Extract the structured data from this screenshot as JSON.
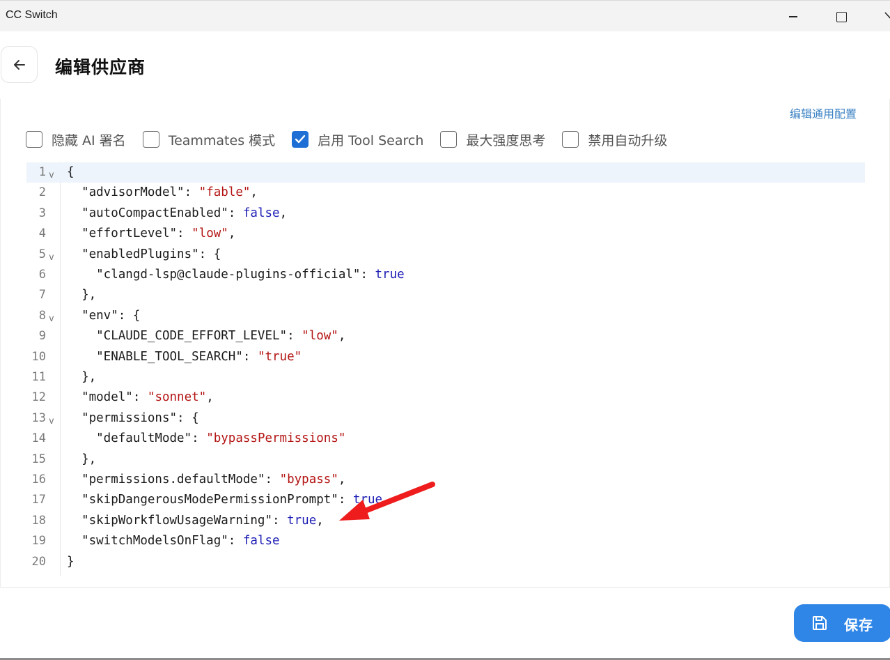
{
  "window": {
    "title": "CC Switch"
  },
  "header": {
    "title": "编辑供应商"
  },
  "content": {
    "edit_common_link": "编辑通用配置",
    "checkboxes": [
      {
        "label": "隐藏 AI 署名",
        "checked": false
      },
      {
        "label": "Teammates 模式",
        "checked": false
      },
      {
        "label": "启用 Tool Search",
        "checked": true
      },
      {
        "label": "最大强度思考",
        "checked": false
      },
      {
        "label": "禁用自动升级",
        "checked": false
      }
    ]
  },
  "editor": {
    "active_line": 1,
    "lines": [
      {
        "n": "1",
        "fold": true,
        "tokens": [
          [
            "p",
            "{"
          ]
        ]
      },
      {
        "n": "2",
        "fold": false,
        "tokens": [
          [
            "k",
            "  \"advisorModel\""
          ],
          [
            "p",
            ": "
          ],
          [
            "s",
            "\"fable\""
          ],
          [
            "p",
            ","
          ]
        ]
      },
      {
        "n": "3",
        "fold": false,
        "tokens": [
          [
            "k",
            "  \"autoCompactEnabled\""
          ],
          [
            "p",
            ": "
          ],
          [
            "w",
            "false"
          ],
          [
            "p",
            ","
          ]
        ]
      },
      {
        "n": "4",
        "fold": false,
        "tokens": [
          [
            "k",
            "  \"effortLevel\""
          ],
          [
            "p",
            ": "
          ],
          [
            "s",
            "\"low\""
          ],
          [
            "p",
            ","
          ]
        ]
      },
      {
        "n": "5",
        "fold": true,
        "tokens": [
          [
            "k",
            "  \"enabledPlugins\""
          ],
          [
            "p",
            ": {"
          ]
        ]
      },
      {
        "n": "6",
        "fold": false,
        "tokens": [
          [
            "k",
            "    \"clangd-lsp@claude-plugins-official\""
          ],
          [
            "p",
            ": "
          ],
          [
            "w",
            "true"
          ]
        ]
      },
      {
        "n": "7",
        "fold": false,
        "tokens": [
          [
            "p",
            "  },"
          ]
        ]
      },
      {
        "n": "8",
        "fold": true,
        "tokens": [
          [
            "k",
            "  \"env\""
          ],
          [
            "p",
            ": {"
          ]
        ]
      },
      {
        "n": "9",
        "fold": false,
        "tokens": [
          [
            "k",
            "    \"CLAUDE_CODE_EFFORT_LEVEL\""
          ],
          [
            "p",
            ": "
          ],
          [
            "s",
            "\"low\""
          ],
          [
            "p",
            ","
          ]
        ]
      },
      {
        "n": "10",
        "fold": false,
        "tokens": [
          [
            "k",
            "    \"ENABLE_TOOL_SEARCH\""
          ],
          [
            "p",
            ": "
          ],
          [
            "s",
            "\"true\""
          ]
        ]
      },
      {
        "n": "11",
        "fold": false,
        "tokens": [
          [
            "p",
            "  },"
          ]
        ]
      },
      {
        "n": "12",
        "fold": false,
        "tokens": [
          [
            "k",
            "  \"model\""
          ],
          [
            "p",
            ": "
          ],
          [
            "s",
            "\"sonnet\""
          ],
          [
            "p",
            ","
          ]
        ]
      },
      {
        "n": "13",
        "fold": true,
        "tokens": [
          [
            "k",
            "  \"permissions\""
          ],
          [
            "p",
            ": {"
          ]
        ]
      },
      {
        "n": "14",
        "fold": false,
        "tokens": [
          [
            "k",
            "    \"defaultMode\""
          ],
          [
            "p",
            ": "
          ],
          [
            "s",
            "\"bypassPermissions\""
          ]
        ]
      },
      {
        "n": "15",
        "fold": false,
        "tokens": [
          [
            "p",
            "  },"
          ]
        ]
      },
      {
        "n": "16",
        "fold": false,
        "tokens": [
          [
            "k",
            "  \"permissions.defaultMode\""
          ],
          [
            "p",
            ": "
          ],
          [
            "s",
            "\"bypass\""
          ],
          [
            "p",
            ","
          ]
        ]
      },
      {
        "n": "17",
        "fold": false,
        "tokens": [
          [
            "k",
            "  \"skipDangerousModePermissionPrompt\""
          ],
          [
            "p",
            ": "
          ],
          [
            "w",
            "true"
          ],
          [
            "p",
            ","
          ]
        ]
      },
      {
        "n": "18",
        "fold": false,
        "tokens": [
          [
            "k",
            "  \"skipWorkflowUsageWarning\""
          ],
          [
            "p",
            ": "
          ],
          [
            "w",
            "true"
          ],
          [
            "p",
            ","
          ]
        ]
      },
      {
        "n": "19",
        "fold": false,
        "tokens": [
          [
            "k",
            "  \"switchModelsOnFlag\""
          ],
          [
            "p",
            ": "
          ],
          [
            "w",
            "false"
          ]
        ]
      },
      {
        "n": "20",
        "fold": false,
        "tokens": [
          [
            "p",
            "}"
          ]
        ]
      }
    ]
  },
  "footer": {
    "save_label": "保存"
  },
  "colors": {
    "accent": "#2f86e6",
    "link": "#3b82c4",
    "string": "#b31412",
    "keyword": "#1c1cb5",
    "annotation_arrow": "#ee1c1c"
  },
  "icons": {
    "back": "arrow-left-icon",
    "save": "floppy-disk-icon",
    "fold": "chevron-down-icon",
    "check": "checkmark-icon"
  }
}
